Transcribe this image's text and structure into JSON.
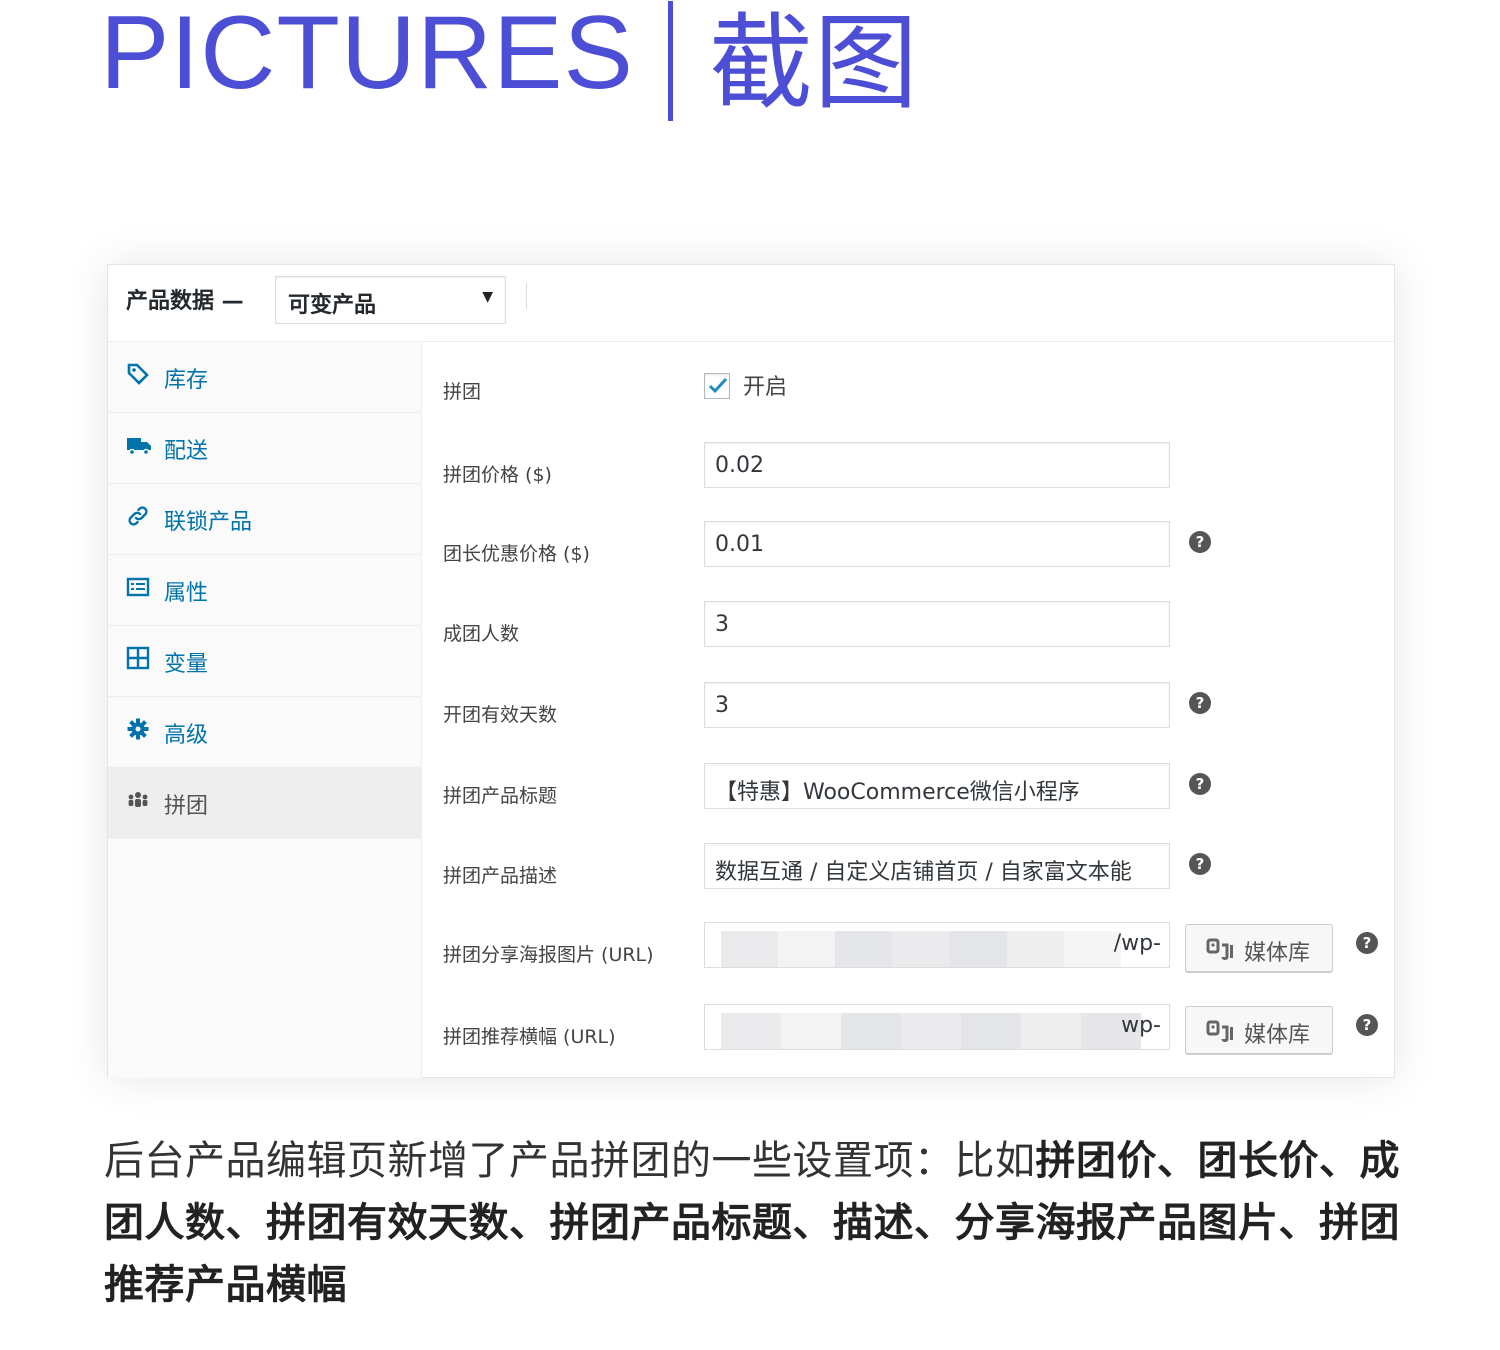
{
  "header": {
    "title_en": "PICTURES",
    "title_zh": "截图"
  },
  "panel": {
    "label": "产品数据 —",
    "product_type": "可变产品",
    "tabs": [
      {
        "label": "库存",
        "icon": "tag-icon"
      },
      {
        "label": "配送",
        "icon": "truck-icon"
      },
      {
        "label": "联锁产品",
        "icon": "link-icon"
      },
      {
        "label": "属性",
        "icon": "list-icon"
      },
      {
        "label": "变量",
        "icon": "grid-icon"
      },
      {
        "label": "高级",
        "icon": "gear-icon"
      },
      {
        "label": "拼团",
        "icon": "group-icon",
        "active": true
      }
    ],
    "fields": {
      "group_buy": {
        "label": "拼团",
        "checkbox_label": "开启",
        "checked": true
      },
      "group_price": {
        "label": "拼团价格 ($)",
        "value": "0.02"
      },
      "leader_price": {
        "label": "团长优惠价格 ($)",
        "value": "0.01"
      },
      "group_size": {
        "label": "成团人数",
        "value": "3"
      },
      "valid_days": {
        "label": "开团有效天数",
        "value": "3"
      },
      "product_title": {
        "label": "拼团产品标题",
        "value": "【特惠】WooCommerce微信小程序"
      },
      "product_desc": {
        "label": "拼团产品描述",
        "value": "数据互通 / 自定义店铺首页 / 自家富文本能"
      },
      "poster_image": {
        "label": "拼团分享海报图片 (URL)",
        "value_tail": "/wp-"
      },
      "banner": {
        "label": "拼团推荐横幅 (URL)",
        "value_tail": "wp-"
      }
    },
    "media_button": "媒体库",
    "help_glyph": "?"
  },
  "caption": {
    "plain": "后台产品编辑页新增了产品拼团的一些设置项：比如",
    "bold": "拼团价、团长价、成团人数、拼团有效天数、拼团产品标题、描述、分享海报产品图片、拼团推荐产品横幅"
  },
  "colors": {
    "accent": "#4c4ed6",
    "link": "#0073aa"
  }
}
